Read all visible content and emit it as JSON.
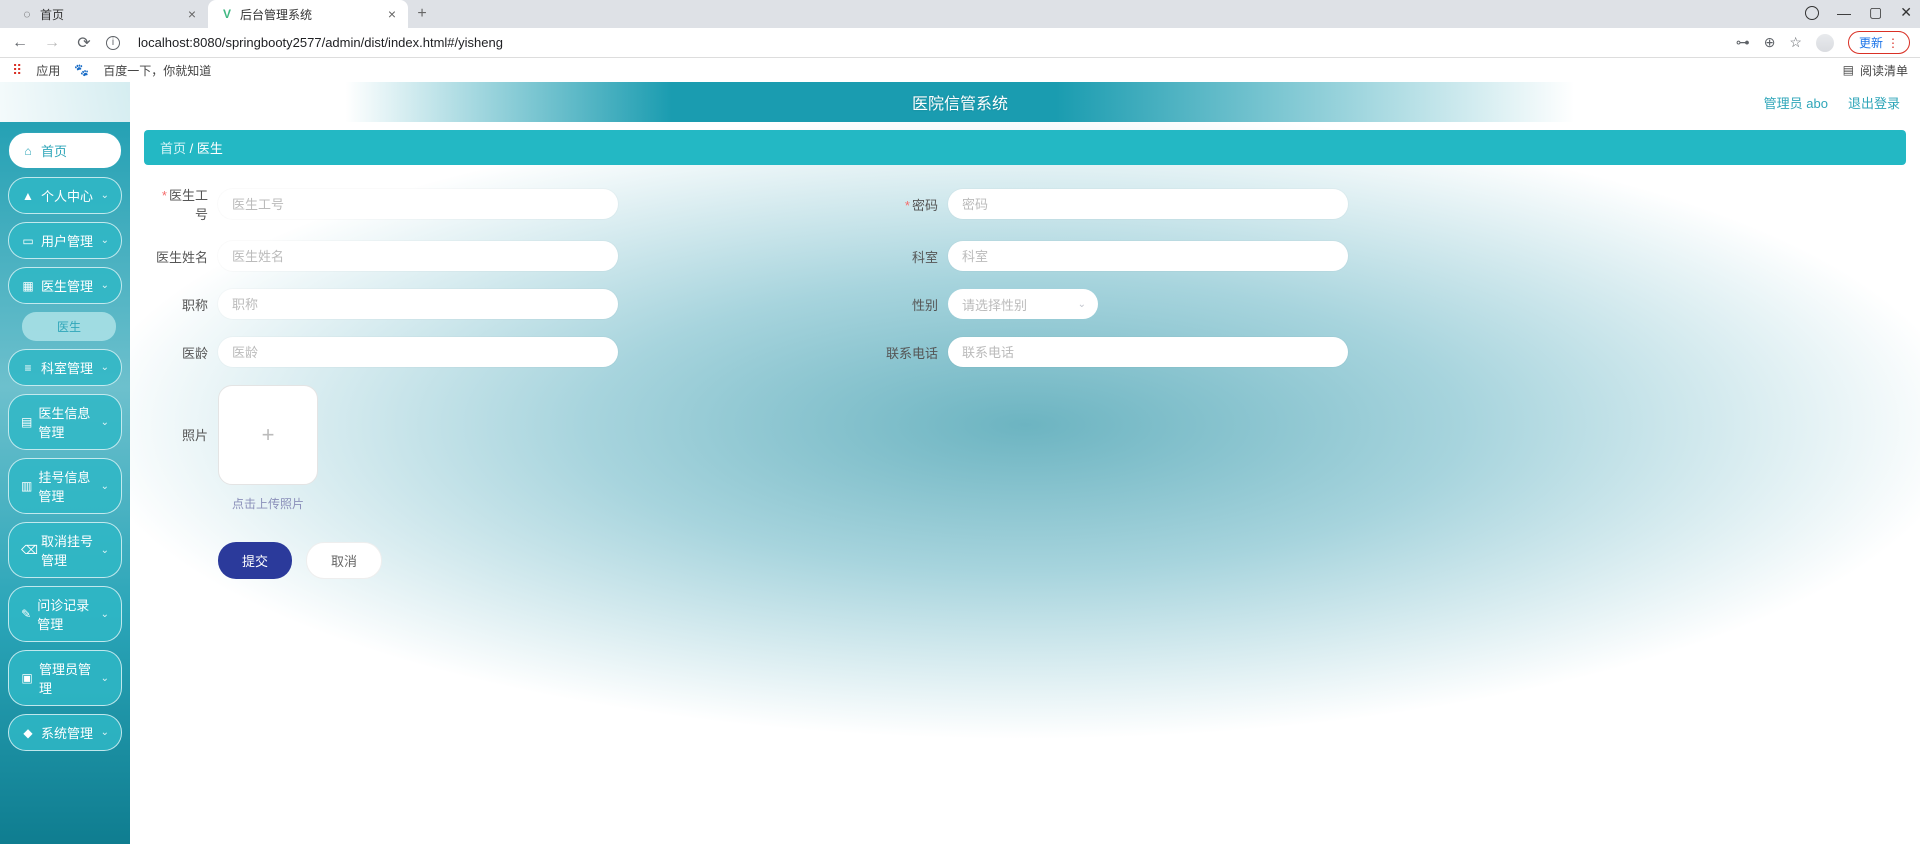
{
  "browser": {
    "tabs": [
      {
        "title": "首页",
        "active": false
      },
      {
        "title": "后台管理系统",
        "active": true
      }
    ],
    "url": "localhost:8080/springbooty2577/admin/dist/index.html#/yisheng",
    "update_label": "更新",
    "bookmarks": {
      "apps": "应用",
      "baidu": "百度一下，你就知道",
      "reading_list": "阅读清单"
    }
  },
  "header": {
    "title": "医院信管系统",
    "user_label": "管理员 abo",
    "logout_label": "退出登录"
  },
  "sidebar": {
    "home": "首页",
    "items": [
      {
        "icon": "person",
        "label": "个人中心"
      },
      {
        "icon": "users",
        "label": "用户管理"
      },
      {
        "icon": "grid",
        "label": "医生管理",
        "sub": "医生"
      },
      {
        "icon": "list",
        "label": "科室管理"
      },
      {
        "icon": "doc",
        "label": "医生信息管理"
      },
      {
        "icon": "ticket",
        "label": "挂号信息管理"
      },
      {
        "icon": "cancel",
        "label": "取消挂号管理"
      },
      {
        "icon": "record",
        "label": "问诊记录管理"
      },
      {
        "icon": "admin",
        "label": "管理员管理"
      },
      {
        "icon": "gear",
        "label": "系统管理"
      }
    ]
  },
  "breadcrumb": {
    "home": "首页",
    "sep": "/",
    "current": "医生"
  },
  "form": {
    "doctor_id": {
      "label": "医生工号",
      "placeholder": "医生工号",
      "required": true
    },
    "password": {
      "label": "密码",
      "placeholder": "密码",
      "required": true
    },
    "doctor_name": {
      "label": "医生姓名",
      "placeholder": "医生姓名"
    },
    "department": {
      "label": "科室",
      "placeholder": "科室"
    },
    "title": {
      "label": "职称",
      "placeholder": "职称"
    },
    "gender": {
      "label": "性别",
      "placeholder": "请选择性别"
    },
    "age": {
      "label": "医龄",
      "placeholder": "医龄"
    },
    "phone": {
      "label": "联系电话",
      "placeholder": "联系电话"
    },
    "photo": {
      "label": "照片",
      "tip": "点击上传照片"
    }
  },
  "actions": {
    "submit": "提交",
    "cancel": "取消"
  }
}
